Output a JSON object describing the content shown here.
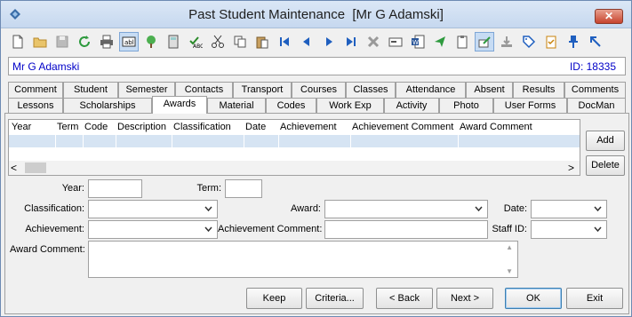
{
  "window": {
    "title": "Past Student Maintenance  [Mr G Adamski]",
    "close_label": "✕"
  },
  "student": {
    "name": "Mr G Adamski",
    "id_label": "ID: 18335"
  },
  "tabs_row1": [
    "Comment",
    "Student",
    "Semester",
    "Contacts",
    "Transport",
    "Courses",
    "Classes",
    "Attendance",
    "Absent",
    "Results",
    "Comments"
  ],
  "tabs_row2": [
    "Lessons",
    "Scholarships",
    "Awards",
    "Material",
    "Codes",
    "Work Exp",
    "Activity",
    "Photo",
    "User Forms",
    "DocMan"
  ],
  "selected_tab": "Awards",
  "grid": {
    "columns": [
      "Year",
      "Term",
      "Code",
      "Description",
      "Classification",
      "Date",
      "Achievement",
      "Achievement Comment",
      "Award Comment"
    ],
    "scroll_left": "<",
    "scroll_right": ">"
  },
  "side_buttons": {
    "add": "Add",
    "delete": "Delete"
  },
  "form": {
    "year_label": "Year:",
    "year_value": "",
    "term_label": "Term:",
    "term_value": "",
    "classification_label": "Classification:",
    "classification_value": "",
    "award_label": "Award:",
    "award_value": "",
    "date_label": "Date:",
    "date_value": "",
    "achievement_label": "Achievement:",
    "achievement_value": "",
    "achievement_comment_label": "Achievement Comment:",
    "achievement_comment_value": "",
    "staff_id_label": "Staff ID:",
    "staff_id_value": "",
    "award_comment_label": "Award Comment:",
    "award_comment_value": ""
  },
  "buttons": {
    "keep": "Keep",
    "criteria": "Criteria...",
    "back": "< Back",
    "next": "Next >",
    "ok": "OK",
    "exit": "Exit"
  },
  "colors": {
    "accent_text": "#0000c8",
    "title_bar": "#c6d8ef",
    "close_button": "#c7432d",
    "grid_selection": "#d6e4f3"
  },
  "toolbar_icons": [
    "new-document-icon",
    "open-folder-icon",
    "save-icon",
    "refresh-icon",
    "print-icon",
    "text-field-icon",
    "tree-icon",
    "calculator-icon",
    "spellcheck-icon",
    "cut-icon",
    "copy-icon",
    "paste-icon",
    "first-record-icon",
    "previous-record-icon",
    "next-record-icon",
    "last-record-icon",
    "delete-icon",
    "card-icon",
    "word-document-icon",
    "send-icon",
    "clipboard-icon",
    "edit-icon",
    "download-icon",
    "tag-icon",
    "checklist-icon",
    "pin-icon",
    "arrow-up-left-icon"
  ]
}
